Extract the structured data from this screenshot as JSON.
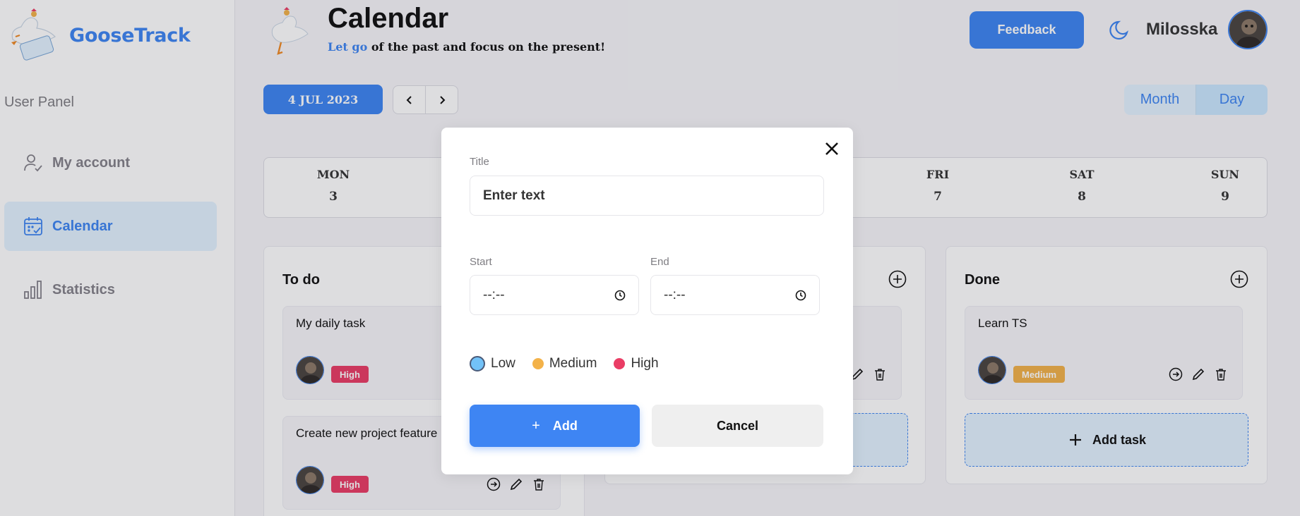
{
  "app": {
    "logo_text": "GooseTrack",
    "accent": "#3e85f3"
  },
  "sidebar": {
    "panel_label": "User Panel",
    "items": [
      {
        "label": "My account",
        "icon": "user-check-icon",
        "active": false
      },
      {
        "label": "Calendar",
        "icon": "calendar-check-icon",
        "active": true
      },
      {
        "label": "Statistics",
        "icon": "bar-chart-icon",
        "active": false
      }
    ]
  },
  "header": {
    "title": "Calendar",
    "motto_accent": "Let go",
    "motto_rest": " of the past and focus on the present!",
    "feedback_label": "Feedback",
    "user_name": "Milosska",
    "theme_icon": "moon-icon"
  },
  "toolbar": {
    "date": "4 JUL 2023",
    "prev_icon": "chevron-left-icon",
    "next_icon": "chevron-right-icon",
    "view_month": "Month",
    "view_day": "Day",
    "active_view": "Day"
  },
  "week": [
    {
      "name": "MON",
      "date": "3"
    },
    {
      "name": "FRI",
      "date": "7"
    },
    {
      "name": "SAT",
      "date": "8"
    },
    {
      "name": "SUN",
      "date": "9"
    }
  ],
  "columns": {
    "todo": {
      "title": "To do",
      "tasks": [
        {
          "text": "My daily task",
          "priority": "High"
        },
        {
          "text": "Create new project feature",
          "priority": "High"
        }
      ]
    },
    "done": {
      "title": "Done",
      "tasks": [
        {
          "text": "Learn TS",
          "priority": "Medium"
        }
      ],
      "add_label": "Add task"
    }
  },
  "modal": {
    "title_label": "Title",
    "title_placeholder": "Enter text",
    "start_label": "Start",
    "start_value": "--:--",
    "end_label": "End",
    "end_value": "--:--",
    "priorities": [
      "Low",
      "Medium",
      "High"
    ],
    "selected_priority": "Low",
    "add_plus": "+",
    "add_label": "Add",
    "cancel_label": "Cancel",
    "colors": {
      "low": "#72c2f8",
      "medium": "#f3b249",
      "high": "#ea3d65"
    }
  }
}
